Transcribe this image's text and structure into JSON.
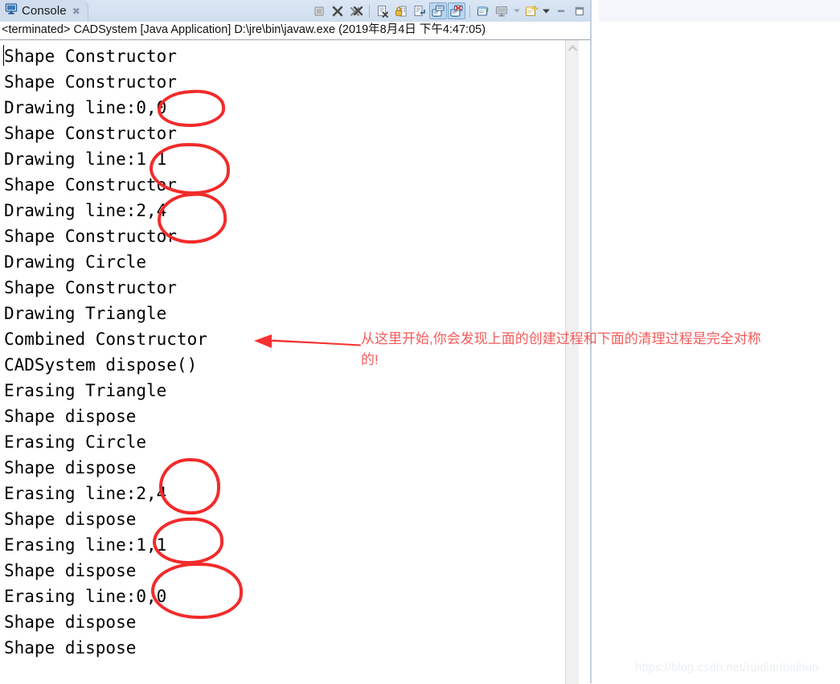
{
  "window": {
    "title": "Console",
    "tab_close_glyph": "✖"
  },
  "tab": {
    "label": "Console",
    "icon": "console-monitor-icon"
  },
  "toolbar": {
    "buttons": [
      {
        "name": "terminate-button",
        "icon": "terminate-stop-icon",
        "pressed": false
      },
      {
        "name": "remove-launch-button",
        "icon": "remove-launch-x-icon",
        "pressed": false
      },
      {
        "name": "remove-all-terminated-button",
        "icon": "remove-all-terminated-icon",
        "pressed": false
      },
      {
        "name": "clear-console-button",
        "icon": "clear-console-icon",
        "pressed": false
      },
      {
        "name": "lock-scroll-button",
        "icon": "scroll-lock-icon",
        "pressed": false
      },
      {
        "name": "word-wrap-button",
        "icon": "word-wrap-icon",
        "pressed": false
      },
      {
        "name": "show-console-on-output-button",
        "icon": "show-console-output-icon",
        "pressed": true
      },
      {
        "name": "show-console-on-error-button",
        "icon": "show-console-error-icon",
        "pressed": true
      },
      {
        "name": "pin-console-button",
        "icon": "pin-console-icon",
        "pressed": false
      },
      {
        "name": "display-selected-console-button",
        "icon": "display-console-icon",
        "pressed": false
      },
      {
        "name": "display-selected-console-dropdown",
        "icon": "chevron-down-icon",
        "pressed": false
      },
      {
        "name": "open-console-button",
        "icon": "open-console-new-icon",
        "pressed": false
      },
      {
        "name": "open-console-dropdown",
        "icon": "chevron-down-icon",
        "pressed": false
      },
      {
        "name": "minimize-view-button",
        "icon": "minimize-icon",
        "pressed": false
      },
      {
        "name": "maximize-view-button",
        "icon": "maximize-icon",
        "pressed": false
      }
    ]
  },
  "process": {
    "status_line": "<terminated> CADSystem [Java Application] D:\\jre\\bin\\javaw.exe (2019年8月4日 下午4:47:05)"
  },
  "console": {
    "lines": [
      "Shape Constructor",
      "Shape Constructor",
      "Drawing line:0,0",
      "Shape Constructor",
      "Drawing line:1,1",
      "Shape Constructor",
      "Drawing line:2,4",
      "Shape Constructor",
      "Drawing Circle",
      "Shape Constructor",
      "Drawing Triangle",
      "Combined Constructor",
      "CADSystem dispose()",
      "Erasing Triangle",
      "Shape dispose",
      "Erasing Circle",
      "Shape dispose",
      "Erasing line:2,4",
      "Shape dispose",
      "Erasing line:1,1",
      "Shape dispose",
      "Erasing line:0,0",
      "Shape dispose",
      "Shape dispose"
    ]
  },
  "scrollbar": {
    "up_arrow_glyph": "⌃"
  },
  "annotation": {
    "color": "#f45b5b",
    "circle_color": "#f22b2b",
    "text_line1": "从这里开始,你会发现上面的创建过程和下面的清理过程是完全对称",
    "text_line2": "的!",
    "arrow_name": "red-arrow-pointing-left",
    "circles": [
      {
        "name": "circle-drawing-line-0-0"
      },
      {
        "name": "circle-drawing-line-1-1"
      },
      {
        "name": "circle-drawing-line-2-4"
      },
      {
        "name": "circle-erasing-line-2-4"
      },
      {
        "name": "circle-erasing-line-1-1"
      },
      {
        "name": "circle-erasing-line-0-0"
      }
    ]
  },
  "watermark": {
    "text": "https://blog.csdn.net/ruidianbaihuo"
  }
}
